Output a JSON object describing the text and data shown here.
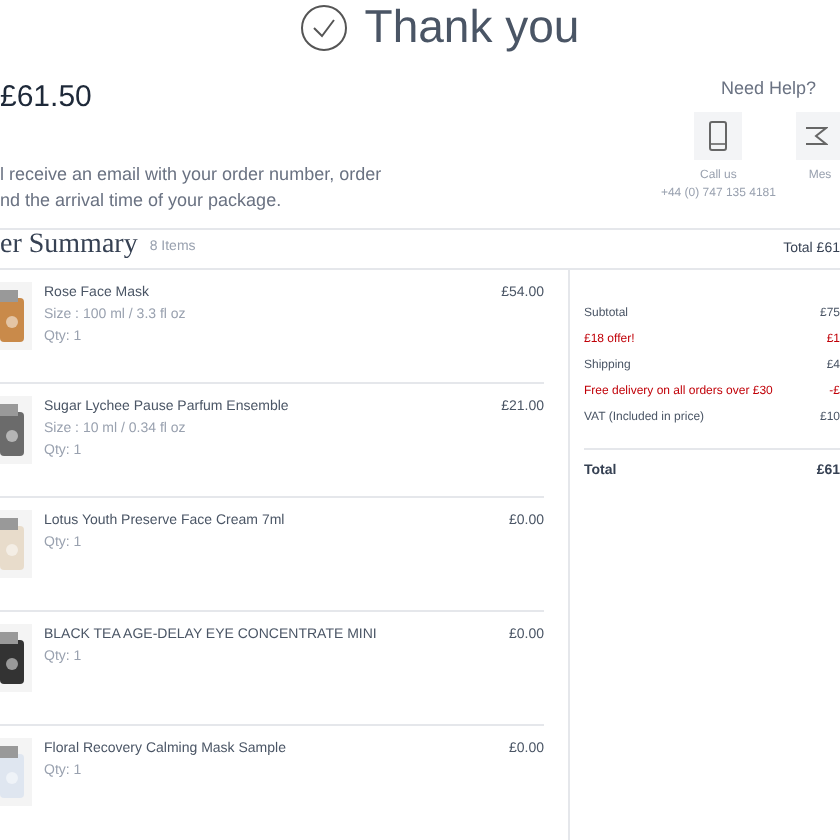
{
  "header": {
    "title": "Thank you"
  },
  "order": {
    "amount": "£61.50",
    "message_lines": [
      "l receive an email with your order number, order",
      "nd the arrival time of your package."
    ]
  },
  "help": {
    "title": "Need Help?",
    "options": [
      {
        "kind": "phone",
        "label": "Call us",
        "detail": "+44 (0) 747 135 4181"
      },
      {
        "kind": "message",
        "label": "Mes"
      }
    ]
  },
  "summary": {
    "title": "er Summary",
    "count": "8 Items",
    "total": "Total £61"
  },
  "items": [
    {
      "name": "Rose Face Mask",
      "size": "Size : 100 ml / 3.3 fl oz",
      "qty": "Qty: 1",
      "price": "£54.00"
    },
    {
      "name": "Sugar Lychee Pause Parfum Ensemble",
      "size": "Size : 10 ml / 0.34 fl oz",
      "qty": "Qty: 1",
      "price": "£21.00"
    },
    {
      "name": "Lotus Youth Preserve Face Cream 7ml",
      "qty": "Qty: 1",
      "price": "£0.00"
    },
    {
      "name": "BLACK TEA AGE-DELAY EYE CONCENTRATE MINI",
      "qty": "Qty: 1",
      "price": "£0.00"
    },
    {
      "name": "Floral Recovery Calming Mask Sample",
      "qty": "Qty: 1",
      "price": "£0.00"
    }
  ],
  "totals": [
    {
      "kind": "normal",
      "label": "Subtotal",
      "value": "£75"
    },
    {
      "kind": "discount",
      "label": "£18 offer!",
      "value": "£1"
    },
    {
      "kind": "normal",
      "label": "Shipping",
      "value": "£4"
    },
    {
      "kind": "discount",
      "label": "Free delivery on all orders over £30",
      "value": "-£"
    },
    {
      "kind": "normal",
      "label": "VAT (Included in price)",
      "value": "£10"
    }
  ],
  "grand_total": {
    "label": "Total",
    "value": "£61"
  }
}
